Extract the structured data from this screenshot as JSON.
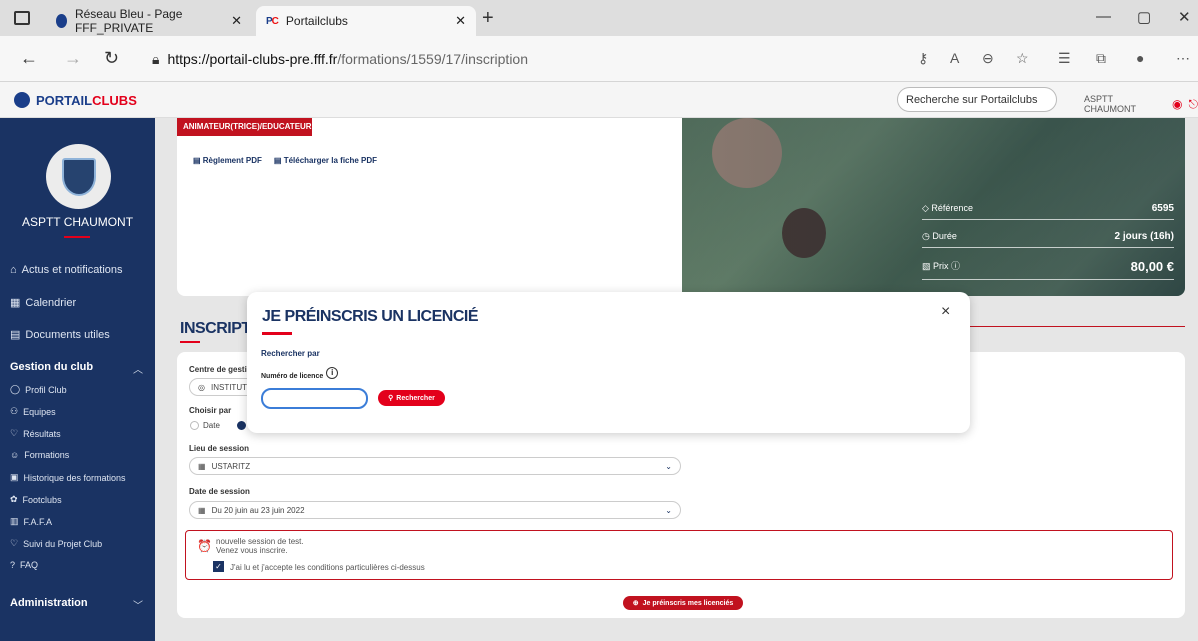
{
  "browser": {
    "tabs": [
      {
        "title": "Réseau Bleu - Page FFF_PRIVATE",
        "active": false
      },
      {
        "title": "Portailclubs",
        "active": true
      }
    ],
    "url_host": "https://portail-clubs-pre.fff.fr",
    "url_path": "/formations/1559/17/inscription"
  },
  "site": {
    "logo_part1": "PORTAIL",
    "logo_part2": "CLUBS",
    "search_placeholder": "Recherche sur Portailclubs",
    "account_name": "ASPTT CHAUMONT"
  },
  "sidebar": {
    "club_name": "ASPTT CHAUMONT",
    "items": [
      {
        "label": "Actus et notifications",
        "icon": "bell-icon"
      },
      {
        "label": "Calendrier",
        "icon": "calendar-icon"
      },
      {
        "label": "Documents utiles",
        "icon": "document-icon"
      }
    ],
    "gestion_header": "Gestion du club",
    "gestion_items": [
      {
        "label": "Profil Club",
        "icon": "shield-icon"
      },
      {
        "label": "Equipes",
        "icon": "team-icon"
      },
      {
        "label": "Résultats",
        "icon": "trophy-icon"
      },
      {
        "label": "Formations",
        "icon": "user-icon"
      },
      {
        "label": "Historique des formations",
        "icon": "history-icon"
      },
      {
        "label": "Footclubs",
        "icon": "ball-icon"
      },
      {
        "label": "F.A.F.A",
        "icon": "fafa-icon"
      },
      {
        "label": "Suivi du Projet Club",
        "icon": "trophy-icon"
      },
      {
        "label": "FAQ",
        "icon": "question-icon"
      }
    ],
    "admin_header": "Administration"
  },
  "formation": {
    "role_badge": "ANIMATEUR(TRICE)/EDUCATEUR(TRICE)",
    "reglement_link": "Règlement PDF",
    "fiche_link": "Télécharger la fiche PDF",
    "reference_label": "Référence",
    "reference_value": "6595",
    "duree_label": "Durée",
    "duree_value": "2 jours (16h)",
    "prix_label": "Prix",
    "prix_value": "80,00 €"
  },
  "inscription": {
    "title": "INSCRIPTION",
    "centre_label": "Centre de gestion",
    "centre_value": "INSTITUT D",
    "choisir_label": "Choisir par",
    "radio_date": "Date",
    "lieu_label": "Lieu de session",
    "lieu_value": "USTARITZ",
    "date_label": "Date de session",
    "date_value": "Du 20 juin au 23 juin 2022",
    "alert_line1": "nouvelle session de test.",
    "alert_line2": "Venez vous inscrire.",
    "accept_text": "J'ai lu et j'accepte les conditions particulières ci-dessus",
    "submit_label": "Je préinscris mes licenciés"
  },
  "modal": {
    "title": "JE PRÉINSCRIS UN LICENCIÉ",
    "close": "×",
    "rechercher_par": "Rechercher par",
    "licence_label": "Numéro de licence",
    "licence_value": "",
    "search_button": "Rechercher"
  }
}
